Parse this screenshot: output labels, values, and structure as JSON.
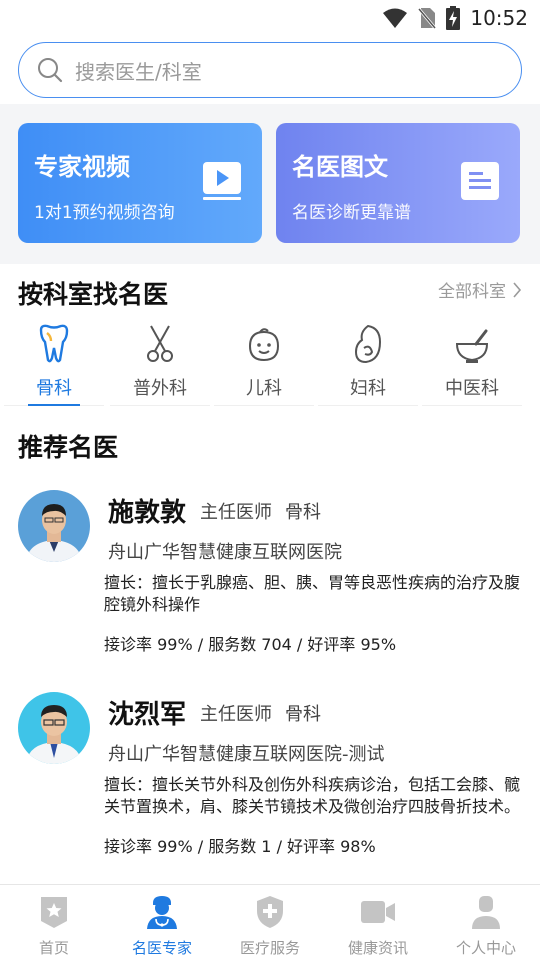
{
  "status": {
    "time": "10:52"
  },
  "search": {
    "placeholder": "搜索医生/科室"
  },
  "cards": [
    {
      "title": "专家视频",
      "subtitle": "1对1预约视频咨询",
      "icon": "video-play-icon"
    },
    {
      "title": "名医图文",
      "subtitle": "名医诊断更靠谱",
      "icon": "document-icon"
    }
  ],
  "departments": {
    "title": "按科室找名医",
    "all_link": "全部科室",
    "items": [
      {
        "label": "骨科",
        "icon": "tooth-bone-icon",
        "active": true
      },
      {
        "label": "普外科",
        "icon": "scissors-icon",
        "active": false
      },
      {
        "label": "儿科",
        "icon": "baby-face-icon",
        "active": false
      },
      {
        "label": "妇科",
        "icon": "pregnancy-icon",
        "active": false
      },
      {
        "label": "中医科",
        "icon": "mortar-pestle-icon",
        "active": false
      }
    ]
  },
  "recommend": {
    "title": "推荐名医",
    "doctors": [
      {
        "name": "施敦敦",
        "title": "主任医师",
        "dept": "骨科",
        "hospital": "舟山广华智慧健康互联网医院",
        "skill": "擅长：擅长于乳腺癌、胆、胰、胃等良恶性疾病的治疗及腹腔镜外科操作",
        "stats": "接诊率 99% / 服务数 704 / 好评率 95%"
      },
      {
        "name": "沈烈军",
        "title": "主任医师",
        "dept": "骨科",
        "hospital": "舟山广华智慧健康互联网医院-测试",
        "skill": "擅长：擅长关节外科及创伤外科疾病诊治，包括工会膝、髋关节置换术，肩、膝关节镜技术及微创治疗四肢骨折技术。",
        "stats": "接诊率 99% / 服务数 1 / 好评率 98%"
      }
    ]
  },
  "tabs": [
    {
      "label": "首页",
      "icon": "home-star-icon",
      "active": false
    },
    {
      "label": "名医专家",
      "icon": "doctor-icon",
      "active": true
    },
    {
      "label": "医疗服务",
      "icon": "shield-plus-icon",
      "active": false
    },
    {
      "label": "健康资讯",
      "icon": "video-camera-icon",
      "active": false
    },
    {
      "label": "个人中心",
      "icon": "person-icon",
      "active": false
    }
  ],
  "colors": {
    "accent": "#1f7ae0",
    "card_video": "#4a95f7",
    "card_text": "#8090f3"
  }
}
